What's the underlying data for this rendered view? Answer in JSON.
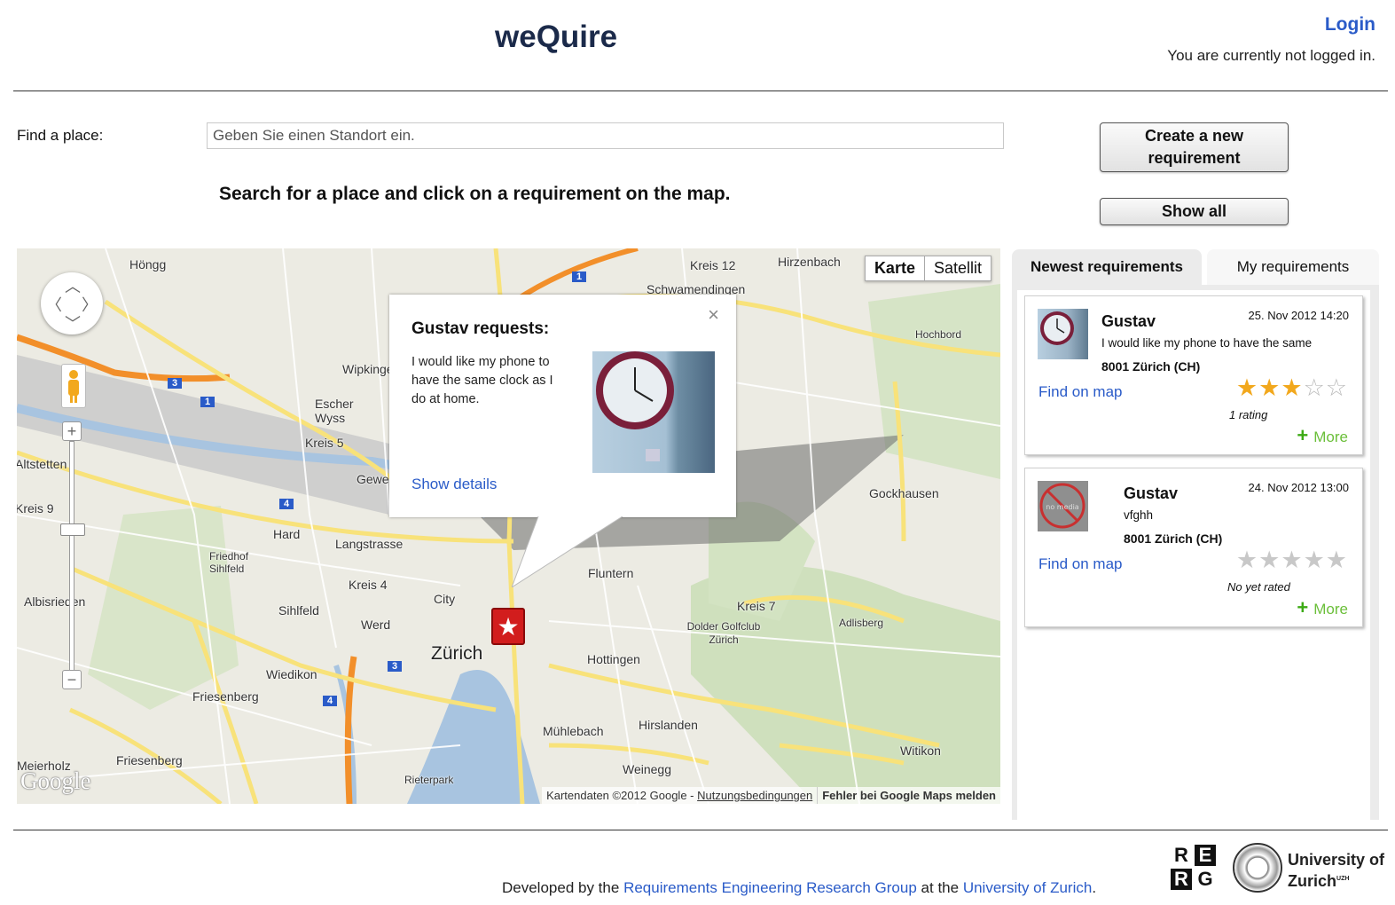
{
  "header": {
    "title": "weQuire",
    "login_label": "Login",
    "login_status": "You are currently not logged in."
  },
  "search": {
    "label": "Find a place:",
    "placeholder": "Geben Sie einen Standort ein.",
    "instruction": "Search for a place and click on a requirement on the map."
  },
  "actions": {
    "create_label": "Create a new requirement",
    "show_all_label": "Show all"
  },
  "map": {
    "type_options": [
      "Karte",
      "Satellit"
    ],
    "selected_type": "Karte",
    "labels": [
      "Höngg",
      "Kreis 12",
      "Hirzenbach",
      "Schwamendingen",
      "Hochbord",
      "Wipkingen",
      "Escher Wyss",
      "Kreis 5",
      "Gewerbeschule",
      "Hard",
      "Langstrasse",
      "Friedhof Sihlfeld",
      "Kreis 4",
      "Albisrieden",
      "Sihlfeld",
      "Werd",
      "City",
      "Zürich",
      "Fluntern",
      "Kreis 7",
      "Dolder Golfclub Zürich",
      "Adlisberg",
      "Hottingen",
      "Wiedikon",
      "Friesenberg",
      "Mühlebach",
      "Hirslanden",
      "Weinegg",
      "Witikon",
      "Gockhausen",
      "Meierholz",
      "Rieterpark",
      "Altstetten",
      "Kreis 9"
    ],
    "attribution": "Kartendaten ©2012 Google -",
    "terms": "Nutzungsbedingungen",
    "report": "Fehler bei Google Maps melden",
    "google_logo": "Google",
    "road_numbers": [
      "1",
      "3",
      "1",
      "4",
      "3",
      "4"
    ]
  },
  "popup": {
    "title": "Gustav requests:",
    "text": "I would like my phone to have the same clock as I do at home.",
    "details_link": "Show details",
    "close": "×"
  },
  "sidebar": {
    "tabs": [
      "Newest requirements",
      "My requirements"
    ],
    "active_tab": "Newest requirements",
    "requirements": [
      {
        "user": "Gustav",
        "date": "25. Nov 2012 14:20",
        "text": "I would like my phone to have the same",
        "location": "8001 Zürich (CH)",
        "find_label": "Find on map",
        "stars_filled": 3,
        "stars_total": 5,
        "rating_text": "1 rating",
        "more_label": "More"
      },
      {
        "user": "Gustav",
        "date": "24. Nov 2012 13:00",
        "text": "vfghh",
        "location": "8001 Zürich (CH)",
        "find_label": "Find on map",
        "stars_filled": 0,
        "stars_total": 5,
        "rating_text": "No yet rated",
        "more_label": "More",
        "no_media_text": "no media"
      }
    ]
  },
  "footer": {
    "prefix": "Developed by the",
    "group_link": "Requirements Engineering Research Group",
    "middle": "at the",
    "uni_link": "University of Zurich",
    "suffix": ".",
    "reg_letters": [
      "R",
      "E",
      "R",
      "G"
    ],
    "uni_logo_line1": "University of",
    "uni_logo_line2": "Zurich",
    "uni_logo_sup": "UZH"
  },
  "colors": {
    "link": "#2a5bc8",
    "title": "#1b2a4a",
    "star": "#f2a81d",
    "more": "#6bbf3a",
    "marker": "#d21d1d"
  }
}
